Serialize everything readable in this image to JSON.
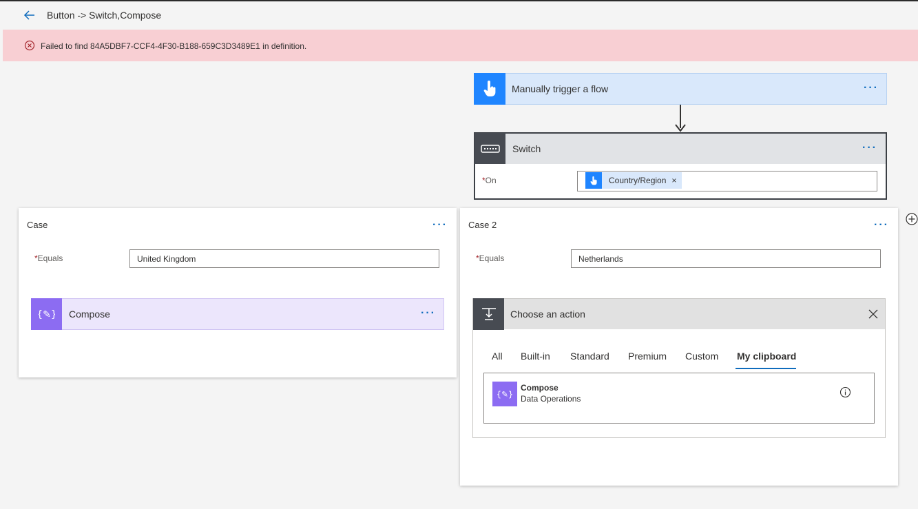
{
  "header": {
    "title": "Button -> Switch,Compose",
    "back_icon": "back-arrow-icon"
  },
  "error": {
    "message": "Failed to find 84A5DBF7-CCF4-4F30-B188-659C3D3489E1 in definition.",
    "icon": "error-circle-icon",
    "color": "#f8cfd3"
  },
  "trigger": {
    "title": "Manually trigger a flow",
    "more": "···",
    "icon": "touch-hand-icon",
    "color": "#1f85ff"
  },
  "switch": {
    "title": "Switch",
    "more": "···",
    "icon": "switch-icon",
    "on_label": "On",
    "required_mark": "*",
    "token": {
      "label": "Country/Region",
      "remove": "×",
      "icon": "touch-hand-icon"
    }
  },
  "cases": [
    {
      "title": "Case",
      "more": "···",
      "equals_label": "Equals",
      "required_mark": "*",
      "equals_value": "United Kingdom",
      "action": {
        "title": "Compose",
        "more": "···",
        "icon": "compose-icon",
        "color": "#8c6cf2"
      }
    },
    {
      "title": "Case 2",
      "more": "···",
      "equals_label": "Equals",
      "required_mark": "*",
      "equals_value": "Netherlands"
    }
  ],
  "choose_action": {
    "title": "Choose an action",
    "tabs": [
      "All",
      "Built-in",
      "Standard",
      "Premium",
      "Custom",
      "My clipboard"
    ],
    "selected_tab": "My clipboard",
    "results": [
      {
        "title": "Compose",
        "subtitle": "Data Operations",
        "icon": "compose-icon"
      }
    ]
  },
  "accent_color": "#0f6cbd"
}
